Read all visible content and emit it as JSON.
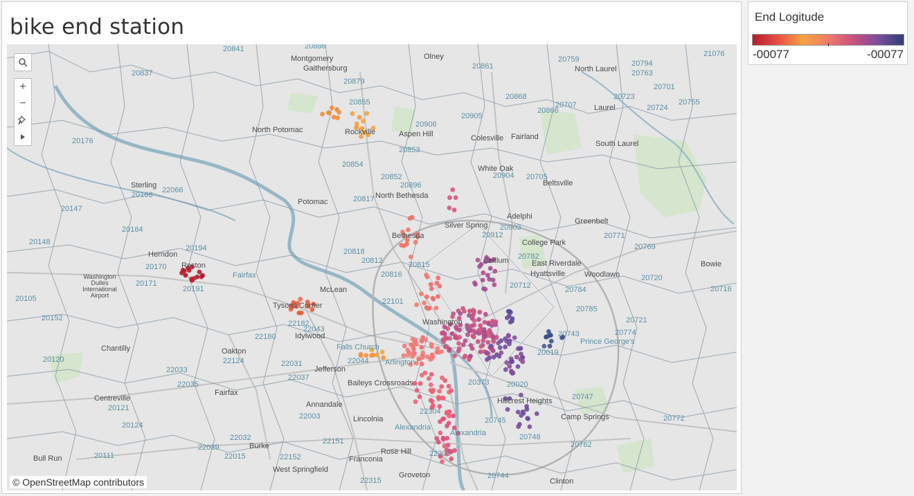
{
  "sheet": {
    "title": "bike end station"
  },
  "legend": {
    "title": "End Logitude",
    "min_label": "-00077",
    "max_label": "-00077",
    "gradient": [
      "#b51d2f",
      "#e84e45",
      "#f4a340",
      "#f07a6a",
      "#c8507e",
      "#7a4e9c",
      "#2e3f73"
    ]
  },
  "attribution": "© OpenStreetMap contributors",
  "toolbar": {
    "search_icon": "search-icon",
    "zoom_in": "+",
    "zoom_out": "−",
    "pin_icon": "pin-icon",
    "expand_icon": "play-icon"
  },
  "colors": {
    "map_bg": "#e6e6e6",
    "water": "#a9c7d3",
    "zip_border": "#7f93a3",
    "road": "#bdbdbd",
    "park": "#cfe3c7"
  },
  "places": [
    "Montgomery",
    "Gaithersburg",
    "Olney",
    "North Laurel",
    "Laurel",
    "North Potomac",
    "Rockville",
    "Aspen Hill",
    "Colesville",
    "Fairland",
    "South Laurel",
    "White Oak",
    "Beltsville",
    "Sterling",
    "Potomac",
    "North Bethesda",
    "Adelphi",
    "Greenbelt",
    "Silver Spring",
    "College Park",
    "Herndon",
    "Reston",
    "Bethesda",
    "Chillum",
    "East Riverdale",
    "Bowie",
    "Hyattsville",
    "Woodlawn",
    "Washington Dulles International Airport",
    "Fairfax",
    "McLean",
    "Tysons Corner",
    "Washington",
    "Idylwood",
    "Chantilly",
    "Oakton",
    "Falls Church",
    "Arlington",
    "Prince George's",
    "Jefferson",
    "Baileys Crossroads",
    "Centreville",
    "Fairfax",
    "Annandale",
    "Hillcrest Heights",
    "Lincolnia",
    "Alexandria",
    "Camp Springs",
    "Burke",
    "Bull Run",
    "Rose Hill",
    "Franconia",
    "West Springfield",
    "Groveton",
    "Clinton",
    "Alexandria"
  ],
  "zip_codes": [
    "20886",
    "20841",
    "20759",
    "20794",
    "20763",
    "21076",
    "20837",
    "20879",
    "20861",
    "20855",
    "20868",
    "20707",
    "20866",
    "20723",
    "20724",
    "20755",
    "20701",
    "20905",
    "20906",
    "20176",
    "20853",
    "20854",
    "20904",
    "20705",
    "20852",
    "20896",
    "20817",
    "20166",
    "20147",
    "20164",
    "20148",
    "20903",
    "20912",
    "20771",
    "20194",
    "20170",
    "20191",
    "20171",
    "20818",
    "20812",
    "20782",
    "20769",
    "20105",
    "20815",
    "20816",
    "20712",
    "20720",
    "20716",
    "22101",
    "20784",
    "20785",
    "20152",
    "22182",
    "22043",
    "22180",
    "20721",
    "20743",
    "20774",
    "20120",
    "22124",
    "22031",
    "22044",
    "20019",
    "22033",
    "22037",
    "22035",
    "20373",
    "20020",
    "20747",
    "20121",
    "22003",
    "20745",
    "20772",
    "20124",
    "22151",
    "22032",
    "22304",
    "20748",
    "20762",
    "22039",
    "22015",
    "22152",
    "22303",
    "20111",
    "22315",
    "20744",
    "22066",
    "20817"
  ]
}
